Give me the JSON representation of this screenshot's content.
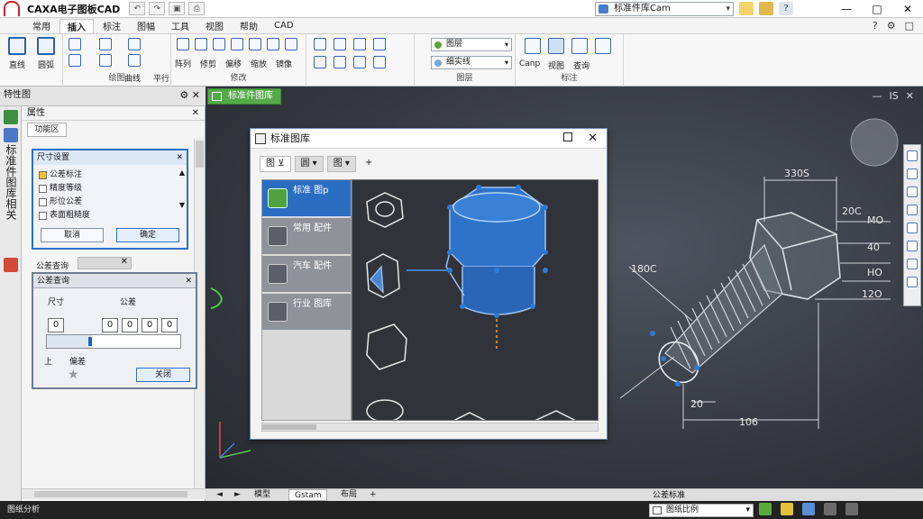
{
  "titlebar": {
    "title": "CAXA电子图板CAD",
    "search_value": "标准件库Cam",
    "icons": [
      "undo-icon",
      "redo-icon",
      "save-icon",
      "print-icon"
    ],
    "window_controls": [
      "—",
      "□",
      "✕"
    ]
  },
  "ribbon": {
    "tabs": [
      "常用",
      "插入",
      "标注",
      "图幅",
      "工具",
      "视图",
      "帮助",
      "CAD"
    ],
    "active_tab": "插入",
    "right_icons": [
      "?",
      "⚙",
      "□"
    ],
    "groups": {
      "draw_label": "绘图",
      "modify_label": "修改",
      "layer_label": "图层",
      "tools_label": "标注"
    },
    "big_buttons": [
      "直线",
      "圆弧"
    ],
    "draw_items": [
      "曲线",
      "平行"
    ],
    "modify_items": [
      "阵列",
      "修剪",
      "偏移",
      "缩放",
      "镜像"
    ],
    "layer_value": "图层",
    "linetype_value": "细实线",
    "tool_items": [
      "Canp",
      "视图",
      "查询"
    ]
  },
  "left_panel": {
    "header_title": "特性图",
    "panel_title": "属性",
    "tab_label": "功能区",
    "strip_text": "标准件图库相关",
    "sub_dialog": {
      "title": "尺寸设置",
      "checks": [
        {
          "label": "公差标注",
          "checked": true
        },
        {
          "label": "精度等级",
          "checked": false
        },
        {
          "label": "形位公差",
          "checked": false
        },
        {
          "label": "表面粗糙度",
          "checked": false
        }
      ],
      "btn_cancel": "取消",
      "btn_ok": "确定"
    },
    "section_label": "公差查询",
    "tol_dialog": {
      "title": "公差查询",
      "head_left": "尺寸",
      "head_right": "公差",
      "cells": [
        "0",
        "0",
        "0",
        "0",
        "0"
      ],
      "lbl_a": "上",
      "lbl_b": "偏差",
      "ok_label": "关闭"
    }
  },
  "canvas": {
    "doc_tab": "标准件图库",
    "controls": [
      "—",
      "IS",
      "✕"
    ],
    "dimensions": {
      "top": "330S",
      "d1": "20C",
      "d2": "MO",
      "d3": "40",
      "d4": "HO",
      "d5": "12O",
      "left": "180C",
      "bottom_small": "20",
      "bottom": "106"
    }
  },
  "library_dialog": {
    "title": "标准图库",
    "toolbar": [
      "图 ⊻",
      "圆 ▾",
      "图 ▾",
      "+"
    ],
    "categories": [
      {
        "label": "标准 图p",
        "active": true
      },
      {
        "label": "常用 配件",
        "active": false
      },
      {
        "label": "汽车 配件",
        "active": false
      },
      {
        "label": "行业 图库",
        "active": false
      }
    ]
  },
  "bottom": {
    "layout_tabs": [
      "◄",
      "►",
      "模型",
      "Gstam",
      "布局",
      "+"
    ],
    "active_layout": "Gstam",
    "status_label": "公差标准",
    "status_value": "图纸比例",
    "status_left": "图纸分析"
  }
}
